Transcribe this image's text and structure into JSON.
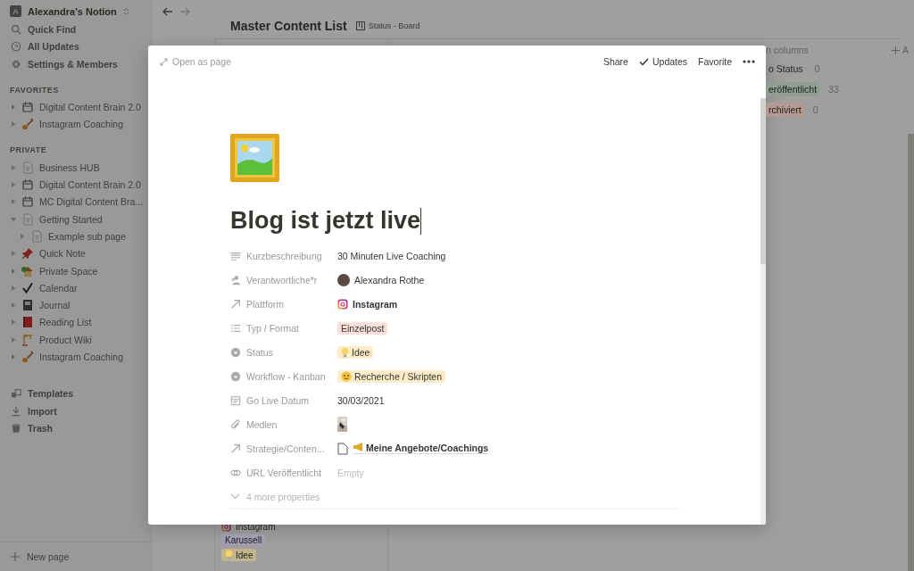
{
  "sidebar": {
    "workspace": {
      "initial": "A",
      "name": "Alexandra's Notion"
    },
    "actions": [
      {
        "label": "Quick Find"
      },
      {
        "label": "All Updates"
      },
      {
        "label": "Settings & Members"
      }
    ],
    "sections": [
      {
        "heading": "FAVORITES",
        "items": [
          {
            "label": "Digital Content Brain 2.0",
            "expanded": false
          },
          {
            "label": "Instagram Coaching",
            "expanded": false
          }
        ]
      },
      {
        "heading": "PRIVATE",
        "items": [
          {
            "label": "Business HUB",
            "expanded": false
          },
          {
            "label": "Digital Content Brain 2.0",
            "expanded": false
          },
          {
            "label": "MC Digital Content Bra...",
            "expanded": false
          },
          {
            "label": "Getting Started",
            "expanded": true,
            "children": [
              {
                "label": "Example sub page",
                "expanded": false
              }
            ]
          },
          {
            "label": "Quick Note",
            "expanded": false
          },
          {
            "label": "Private Space",
            "expanded": false
          },
          {
            "label": "Calendar",
            "expanded": false
          },
          {
            "label": "Journal",
            "expanded": false
          },
          {
            "label": "Reading List",
            "expanded": false
          },
          {
            "label": "Product Wiki",
            "expanded": false
          },
          {
            "label": "Instagram Coaching",
            "expanded": false
          }
        ]
      }
    ],
    "footer_actions": [
      {
        "label": "Templates"
      },
      {
        "label": "Import"
      },
      {
        "label": "Trash"
      }
    ],
    "new_page": "New page"
  },
  "header": {
    "title": "Master Content List",
    "view": "Status - Board"
  },
  "board": {
    "columns_label": "n columns",
    "add_label": "A",
    "groups": [
      {
        "label": "o Status",
        "count": "0"
      },
      {
        "label": "eröffentlicht",
        "count": "33",
        "color": "#8e9e93"
      },
      {
        "label": "rchiviert",
        "count": "0",
        "color": "#b59a91"
      }
    ],
    "card": {
      "platform": "Instagram",
      "tags": [
        {
          "label": "Karussell",
          "color": "#a29cb0"
        },
        {
          "label": "Idee",
          "color": "#c4b48e"
        }
      ]
    }
  },
  "modal": {
    "open_as_page": "Open as page",
    "actions": [
      "Share",
      "Updates",
      "Favorite"
    ],
    "title": "Blog ist jetzt live",
    "properties": [
      {
        "label": "Kurzbeschreibung",
        "value": {
          "kind": "text",
          "text": "30 Minuten Live Coaching"
        }
      },
      {
        "label": "Verantwortliche*r",
        "value": {
          "kind": "person",
          "text": "Alexandra Rothe"
        }
      },
      {
        "label": "Plattform",
        "value": {
          "kind": "platform",
          "text": "Instagram"
        }
      },
      {
        "label": "Typ / Format",
        "value": {
          "kind": "tag",
          "text": "Einzelpost",
          "color": "#fbe0d9"
        }
      },
      {
        "label": "Status",
        "value": {
          "kind": "tag",
          "text": "Idee",
          "color": "#fdecc8"
        }
      },
      {
        "label": "Workflow - Kanban",
        "value": {
          "kind": "tag",
          "text": "Recherche / Skripten",
          "color": "#fdecc8"
        }
      },
      {
        "label": "Go Live Datum",
        "value": {
          "kind": "text",
          "text": "30/03/2021"
        }
      },
      {
        "label": "Medien",
        "value": {
          "kind": "file"
        }
      },
      {
        "label": "Strategie/Conten...",
        "value": {
          "kind": "relation",
          "text": "Meine Angebote/Coachings"
        }
      },
      {
        "label": "URL Veröffentlicht",
        "value": {
          "kind": "empty",
          "text": "Empty"
        }
      }
    ],
    "more_properties": "4 more properties"
  }
}
